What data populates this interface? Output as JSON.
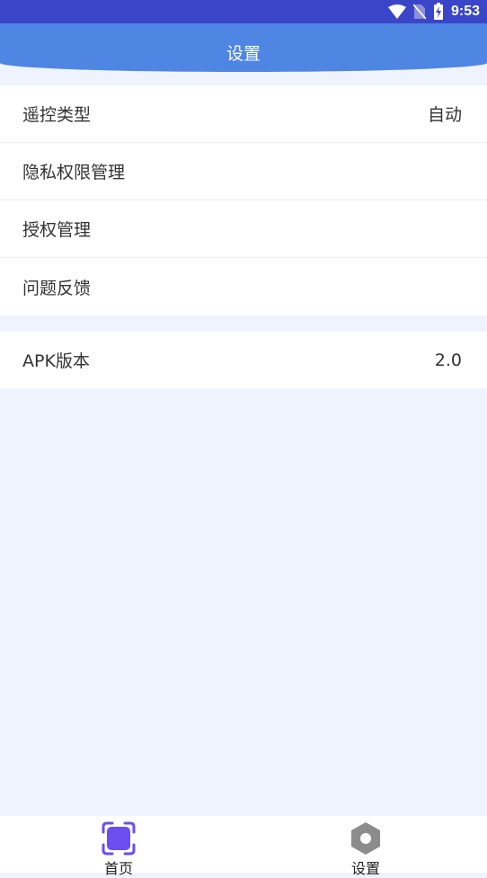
{
  "status_bar": {
    "time": "9:53"
  },
  "header": {
    "title": "设置"
  },
  "settings": {
    "items": [
      {
        "label": "遥控类型",
        "value": "自动"
      },
      {
        "label": "隐私权限管理",
        "value": ""
      },
      {
        "label": "授权管理",
        "value": ""
      },
      {
        "label": "问题反馈",
        "value": ""
      }
    ],
    "version": {
      "label": "APK版本",
      "value": "2.0"
    }
  },
  "bottom_nav": {
    "home_label": "首页",
    "settings_label": "设置"
  },
  "colors": {
    "status_bar": "#3b45c8",
    "header": "#4f86e3",
    "background": "#eff3fd",
    "home_icon": "#6b4ef0",
    "settings_icon": "#8c8c8c"
  }
}
